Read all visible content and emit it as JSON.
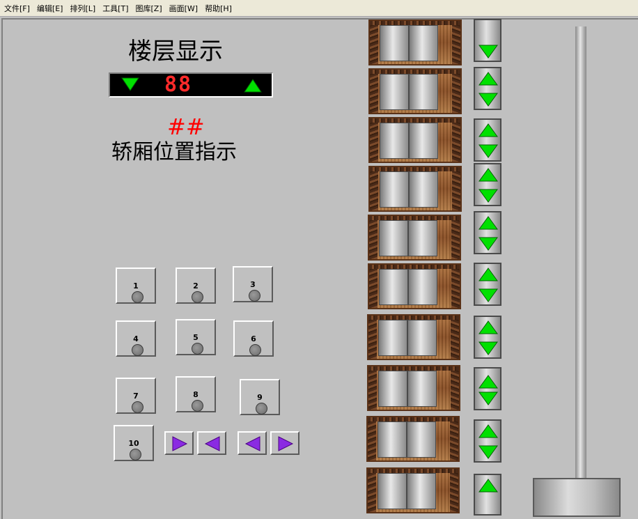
{
  "menu": [
    "文件[F]",
    "编辑[E]",
    "排列[L]",
    "工具[T]",
    "图库[Z]",
    "画面[W]",
    "帮助[H]"
  ],
  "floor_display": {
    "title": "楼层显示",
    "digits": "88"
  },
  "car_position": {
    "marker": "##",
    "label": "轿厢位置指示"
  },
  "car_buttons": [
    "1",
    "2",
    "3",
    "4",
    "5",
    "6",
    "7",
    "8",
    "9",
    "10"
  ],
  "colors": {
    "arrow_green": "#00e000",
    "arrow_purple": "#8a2be2",
    "seven_segment_red": "#ff2a2a",
    "marker_red": "#ff0000",
    "background": "#c0c0c0"
  },
  "icons": {
    "down_arrow": "down-triangle-icon",
    "up_arrow": "up-triangle-icon",
    "right_arrow": "right-triangle-icon",
    "left_arrow": "left-triangle-icon"
  }
}
